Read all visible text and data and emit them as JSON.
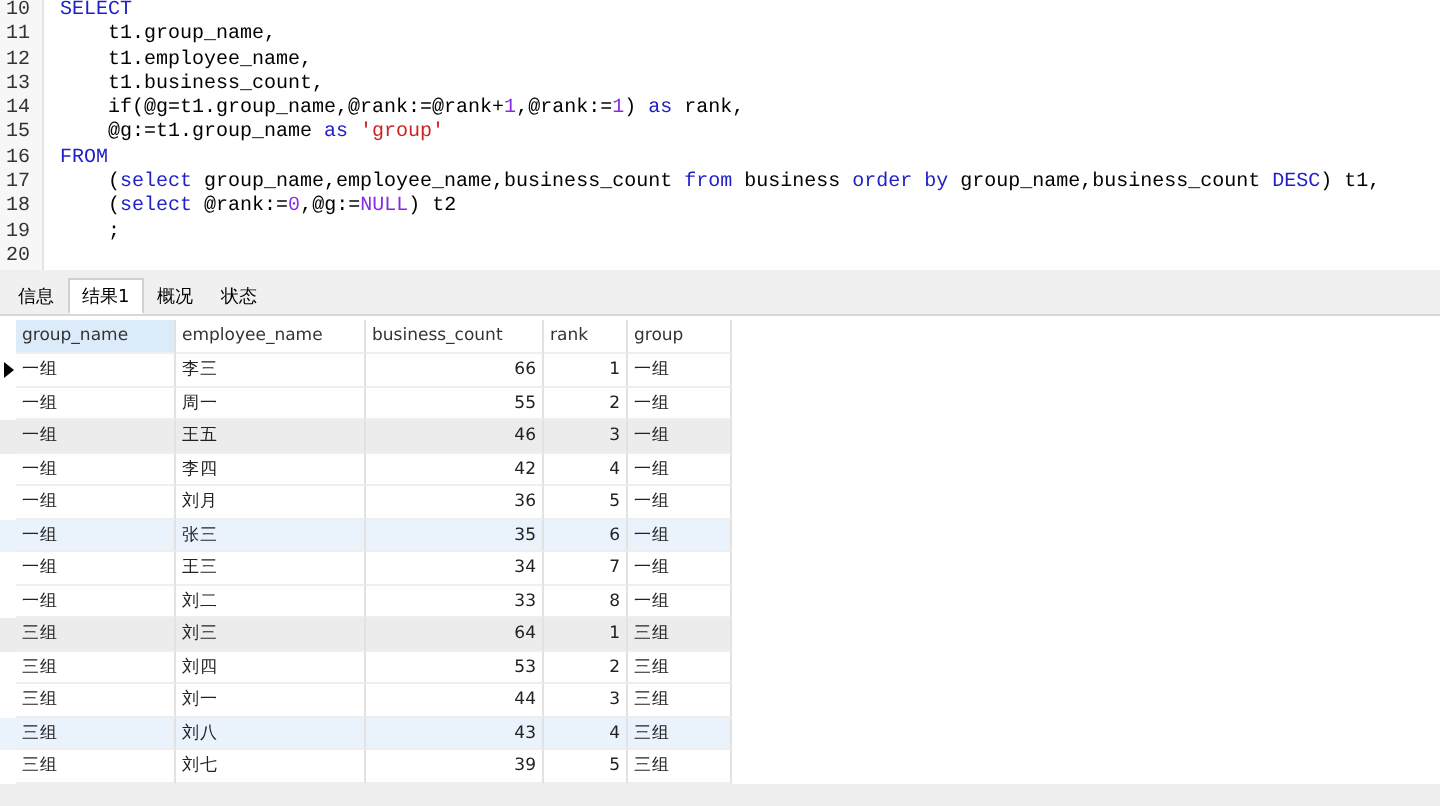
{
  "editor": {
    "lines": [
      {
        "number": "10",
        "tokens": [
          {
            "text": "SELECT",
            "kind": "kw"
          }
        ]
      },
      {
        "number": "11",
        "tokens": [
          {
            "text": "    t1.group_name,",
            "kind": "plain"
          }
        ]
      },
      {
        "number": "12",
        "tokens": [
          {
            "text": "    t1.employee_name,",
            "kind": "plain"
          }
        ]
      },
      {
        "number": "13",
        "tokens": [
          {
            "text": "    t1.business_count,",
            "kind": "plain"
          }
        ]
      },
      {
        "number": "14",
        "tokens": [
          {
            "text": "    if(@g=t1.group_name,@rank:=@rank+",
            "kind": "plain"
          },
          {
            "text": "1",
            "kind": "num"
          },
          {
            "text": ",@rank:=",
            "kind": "plain"
          },
          {
            "text": "1",
            "kind": "num"
          },
          {
            "text": ") ",
            "kind": "plain"
          },
          {
            "text": "as",
            "kind": "kw"
          },
          {
            "text": " rank,",
            "kind": "plain"
          }
        ]
      },
      {
        "number": "15",
        "tokens": [
          {
            "text": "    @g:=t1.group_name ",
            "kind": "plain"
          },
          {
            "text": "as",
            "kind": "kw"
          },
          {
            "text": " 'group'",
            "kind": "str"
          }
        ]
      },
      {
        "number": "16",
        "tokens": [
          {
            "text": "FROM",
            "kind": "kw"
          }
        ]
      },
      {
        "number": "17",
        "tokens": [
          {
            "text": "    (",
            "kind": "plain"
          },
          {
            "text": "select",
            "kind": "kw"
          },
          {
            "text": " group_name,employee_name,business_count ",
            "kind": "plain"
          },
          {
            "text": "from",
            "kind": "kw"
          },
          {
            "text": " business ",
            "kind": "plain"
          },
          {
            "text": "order by",
            "kind": "kw"
          },
          {
            "text": " group_name,business_count ",
            "kind": "plain"
          },
          {
            "text": "DESC",
            "kind": "kw"
          },
          {
            "text": ") t1,",
            "kind": "plain"
          }
        ]
      },
      {
        "number": "18",
        "tokens": [
          {
            "text": "    (",
            "kind": "plain"
          },
          {
            "text": "select",
            "kind": "kw"
          },
          {
            "text": " @rank:=",
            "kind": "plain"
          },
          {
            "text": "0",
            "kind": "num"
          },
          {
            "text": ",@g:=",
            "kind": "plain"
          },
          {
            "text": "NULL",
            "kind": "num"
          },
          {
            "text": ") t2",
            "kind": "plain"
          }
        ]
      },
      {
        "number": "19",
        "tokens": [
          {
            "text": "    ;",
            "kind": "plain"
          }
        ]
      },
      {
        "number": "20"
      }
    ]
  },
  "tabs": [
    {
      "label": "信息",
      "selected": false
    },
    {
      "label": "结果1",
      "selected": true
    },
    {
      "label": "概况",
      "selected": false
    },
    {
      "label": "状态",
      "selected": false
    }
  ],
  "table": {
    "columns": [
      {
        "label": "group_name",
        "selected": true
      },
      {
        "label": "employee_name",
        "selected": false
      },
      {
        "label": "business_count",
        "selected": false
      },
      {
        "label": "rank",
        "selected": false
      },
      {
        "label": "group",
        "selected": false
      }
    ],
    "rows": [
      {
        "current": true,
        "selected": false,
        "marked": false,
        "cells": [
          "一组",
          "李三",
          "66",
          "1",
          "一组"
        ]
      },
      {
        "current": false,
        "selected": false,
        "marked": false,
        "cells": [
          "一组",
          "周一",
          "55",
          "2",
          "一组"
        ]
      },
      {
        "current": false,
        "selected": false,
        "marked": true,
        "cells": [
          "一组",
          "王五",
          "46",
          "3",
          "一组"
        ]
      },
      {
        "current": false,
        "selected": false,
        "marked": false,
        "cells": [
          "一组",
          "李四",
          "42",
          "4",
          "一组"
        ]
      },
      {
        "current": false,
        "selected": false,
        "marked": false,
        "cells": [
          "一组",
          "刘月",
          "36",
          "5",
          "一组"
        ]
      },
      {
        "current": false,
        "selected": true,
        "marked": false,
        "cells": [
          "一组",
          "张三",
          "35",
          "6",
          "一组"
        ]
      },
      {
        "current": false,
        "selected": false,
        "marked": false,
        "cells": [
          "一组",
          "王三",
          "34",
          "7",
          "一组"
        ]
      },
      {
        "current": false,
        "selected": false,
        "marked": false,
        "cells": [
          "一组",
          "刘二",
          "33",
          "8",
          "一组"
        ]
      },
      {
        "current": false,
        "selected": false,
        "marked": true,
        "cells": [
          "三组",
          "刘三",
          "64",
          "1",
          "三组"
        ]
      },
      {
        "current": false,
        "selected": false,
        "marked": false,
        "cells": [
          "三组",
          "刘四",
          "53",
          "2",
          "三组"
        ]
      },
      {
        "current": false,
        "selected": false,
        "marked": false,
        "cells": [
          "三组",
          "刘一",
          "44",
          "3",
          "三组"
        ]
      },
      {
        "current": false,
        "selected": true,
        "marked": false,
        "cells": [
          "三组",
          "刘八",
          "43",
          "4",
          "三组"
        ]
      },
      {
        "current": false,
        "selected": false,
        "marked": false,
        "cells": [
          "三组",
          "刘七",
          "39",
          "5",
          "三组"
        ]
      }
    ]
  }
}
